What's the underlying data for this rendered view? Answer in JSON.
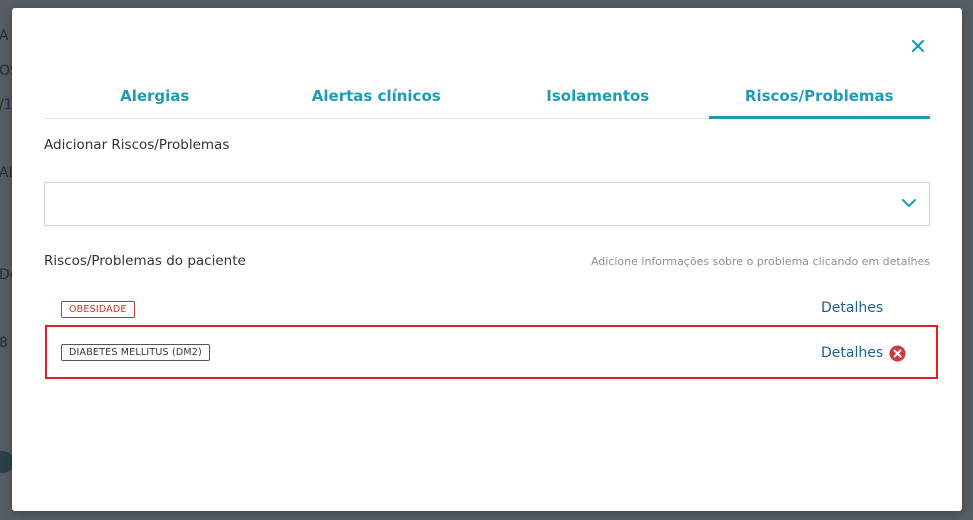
{
  "background": {
    "fragments": [
      "A",
      "OS",
      "/1",
      "AL",
      "Do",
      "8"
    ]
  },
  "modal": {
    "close_icon": "close-icon",
    "tabs": [
      {
        "label": "Alergias",
        "active": false
      },
      {
        "label": "Alertas clínicos",
        "active": false
      },
      {
        "label": "Isolamentos",
        "active": false
      },
      {
        "label": "Riscos/Problemas",
        "active": true
      }
    ],
    "add_section": {
      "label": "Adicionar Riscos/Problemas",
      "select_value": ""
    },
    "list_section": {
      "label": "Riscos/Problemas do paciente",
      "hint": "Adicione informações sobre o problema clicando em detalhes",
      "items": [
        {
          "badge": "OBESIDADE",
          "details_label": "Detalhes",
          "badge_color": "#c0392b"
        },
        {
          "badge": "DIABETES MELLITUS (DM2)",
          "details_label": "Detalhes",
          "badge_color": "#333333"
        }
      ]
    }
  },
  "colors": {
    "accent": "#1f9bb5",
    "link": "#1f5f8b",
    "danger": "#d0393b",
    "highlight": "#e0202a"
  }
}
